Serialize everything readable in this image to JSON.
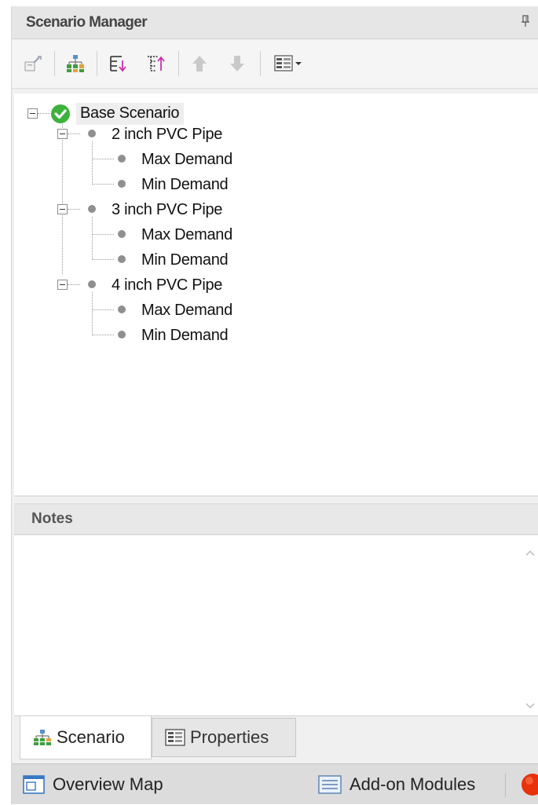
{
  "panel": {
    "title": "Scenario Manager"
  },
  "toolbar": {
    "buttons": [
      "clone-scenario-icon",
      "hierarchy-icon",
      "sort-down-icon",
      "sort-up-icon",
      "move-up-icon",
      "move-down-icon",
      "view-options-icon"
    ]
  },
  "tree": {
    "root": {
      "label": "Base Scenario",
      "status": "ok"
    },
    "children": [
      {
        "label": "2 inch PVC Pipe",
        "children": [
          {
            "label": "Max Demand"
          },
          {
            "label": "Min Demand"
          }
        ]
      },
      {
        "label": "3 inch PVC Pipe",
        "children": [
          {
            "label": "Max Demand"
          },
          {
            "label": "Min Demand"
          }
        ]
      },
      {
        "label": "4 inch PVC Pipe",
        "children": [
          {
            "label": "Max Demand"
          },
          {
            "label": "Min Demand"
          }
        ]
      }
    ]
  },
  "notes": {
    "title": "Notes",
    "text": ""
  },
  "tabs": [
    {
      "label": "Scenario",
      "active": true
    },
    {
      "label": "Properties",
      "active": false
    }
  ],
  "statusbar": {
    "overview_label": "Overview Map",
    "addons_label": "Add-on Modules"
  },
  "colors": {
    "ok_green": "#3cb23c",
    "node_dot": "#8f8f8f",
    "record_red": "#e8320c"
  }
}
